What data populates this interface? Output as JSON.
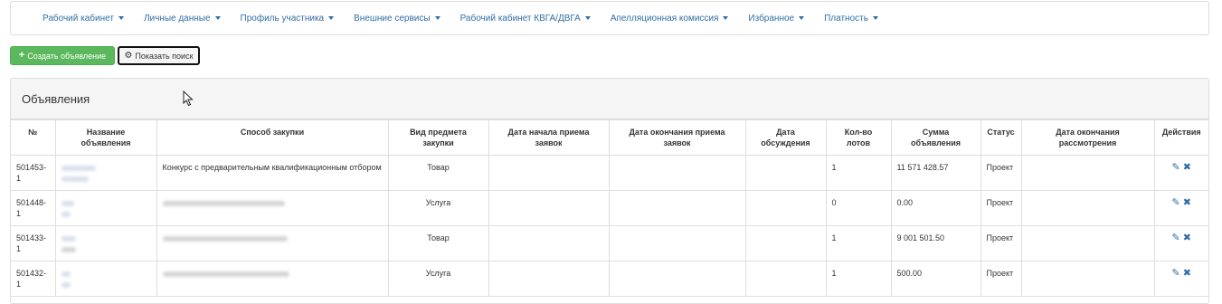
{
  "navbar": {
    "items": [
      {
        "label": "Рабочий кабинет"
      },
      {
        "label": "Личные данные"
      },
      {
        "label": "Профиль участника"
      },
      {
        "label": "Внешние сервисы"
      },
      {
        "label": "Рабочий кабинет КВГА/ДВГА"
      },
      {
        "label": "Апелляционная комиссия"
      },
      {
        "label": "Избранное"
      },
      {
        "label": "Платность"
      }
    ]
  },
  "toolbar": {
    "create_label": "Создать объявление",
    "search_label": "Показать поиск"
  },
  "panel": {
    "title": "Объявления"
  },
  "table": {
    "headers": [
      "№",
      "Название объявления",
      "Способ закупки",
      "Вид предмета закупки",
      "Дата начала приема заявок",
      "Дата окончания приема заявок",
      "Дата обсуждения",
      "Кол-во лотов",
      "Сумма объявления",
      "Статус",
      "Дата окончания рассмотрения",
      "Действия"
    ],
    "rows": [
      {
        "num": "501453-1",
        "method": "Конкурс с предварительным квалификационным отбором",
        "subject": "Товар",
        "start": "",
        "end": "",
        "discussion": "",
        "lots": "1",
        "sum": "11 571 428.57",
        "status": "Проект",
        "review_end": ""
      },
      {
        "num": "501448-1",
        "method": "",
        "subject": "Услуга",
        "start": "",
        "end": "",
        "discussion": "",
        "lots": "0",
        "sum": "0.00",
        "status": "Проект",
        "review_end": ""
      },
      {
        "num": "501433-1",
        "method": "",
        "subject": "Товар",
        "start": "",
        "end": "",
        "discussion": "",
        "lots": "1",
        "sum": "9 001 501.50",
        "status": "Проект",
        "review_end": ""
      },
      {
        "num": "501432-1",
        "method": "",
        "subject": "Услуга",
        "start": "",
        "end": "",
        "discussion": "",
        "lots": "1",
        "sum": "500.00",
        "status": "Проект",
        "review_end": ""
      }
    ]
  },
  "icons": {
    "plus": "plus-icon",
    "gear": "gear-icon",
    "edit": "pencil-icon",
    "delete": "close-icon",
    "cursor": "mouse-pointer-icon"
  },
  "colors": {
    "link": "#2f6ea5",
    "success": "#5cb85c",
    "panel_heading": "#f5f5f5",
    "border": "#dddddd"
  }
}
